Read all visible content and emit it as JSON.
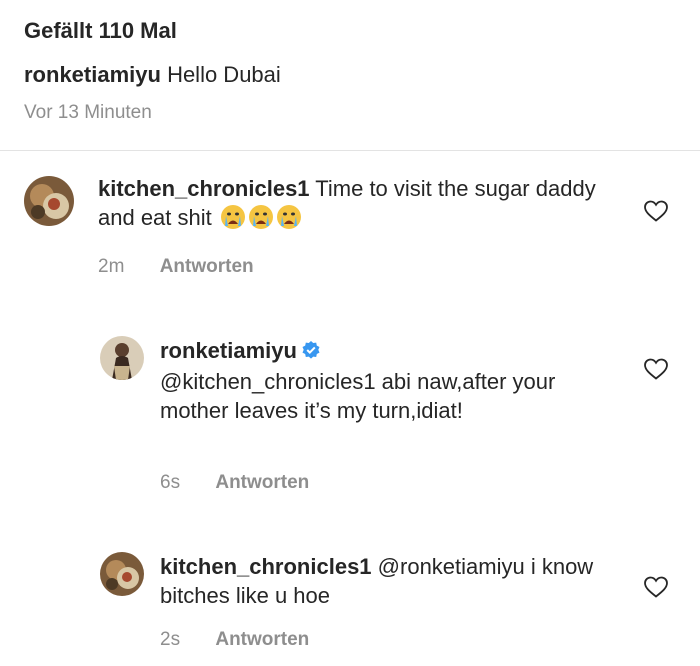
{
  "post": {
    "likes_text": "Gefällt 110 Mal",
    "caption_user": "ronketiamiyu",
    "caption_text": "Hello Dubai",
    "time_ago": "Vor 13 Minuten"
  },
  "comments": [
    {
      "user": "kitchen_chronicles1",
      "text": "Time to visit the sugar daddy and eat shit",
      "emoji": [
        "crying-face-emoji",
        "crying-face-emoji",
        "crying-face-emoji"
      ],
      "age": "2m",
      "reply_label": "Antworten"
    },
    {
      "user": "ronketiamiyu",
      "verified": true,
      "text": "@kitchen_chronicles1 abi naw,after your mother leaves it’s my turn,idiat!",
      "age": "6s",
      "reply_label": "Antworten"
    },
    {
      "user": "kitchen_chronicles1",
      "text": "@ronketiamiyu i know bitches like u hoe",
      "age": "2s",
      "reply_label": "Antworten"
    }
  ],
  "colors": {
    "text": "#262626",
    "secondary": "#8e8e8e",
    "verified": "#3897f0",
    "divider": "#e3e3e3"
  },
  "icons": {
    "like": "heart-outline-icon",
    "verified": "verified-badge-icon"
  }
}
